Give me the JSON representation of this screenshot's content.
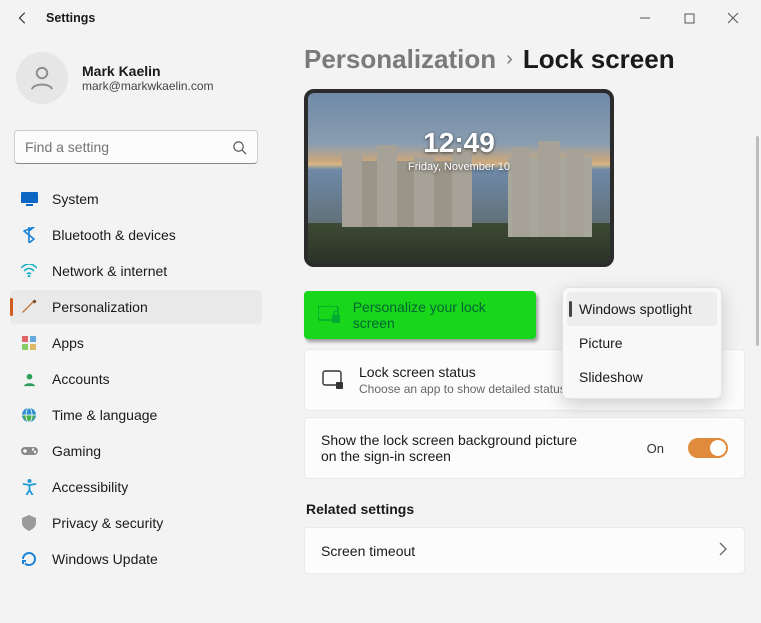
{
  "window": {
    "title": "Settings"
  },
  "profile": {
    "name": "Mark Kaelin",
    "email": "mark@markwkaelin.com"
  },
  "search": {
    "placeholder": "Find a setting"
  },
  "nav": {
    "items": [
      {
        "label": "System",
        "icon": "system",
        "selected": false
      },
      {
        "label": "Bluetooth & devices",
        "icon": "bluetooth",
        "selected": false
      },
      {
        "label": "Network & internet",
        "icon": "network",
        "selected": false
      },
      {
        "label": "Personalization",
        "icon": "personalization",
        "selected": true
      },
      {
        "label": "Apps",
        "icon": "apps",
        "selected": false
      },
      {
        "label": "Accounts",
        "icon": "accounts",
        "selected": false
      },
      {
        "label": "Time & language",
        "icon": "time",
        "selected": false
      },
      {
        "label": "Gaming",
        "icon": "gaming",
        "selected": false
      },
      {
        "label": "Accessibility",
        "icon": "accessibility",
        "selected": false
      },
      {
        "label": "Privacy & security",
        "icon": "privacy",
        "selected": false
      },
      {
        "label": "Windows Update",
        "icon": "update",
        "selected": false
      }
    ]
  },
  "breadcrumb": {
    "parent": "Personalization",
    "current": "Lock screen"
  },
  "preview": {
    "time": "12:49",
    "date": "Friday, November 10"
  },
  "hero": {
    "label": "Personalize your lock screen"
  },
  "dropdown": {
    "options": [
      {
        "label": "Windows spotlight",
        "selected": true
      },
      {
        "label": "Picture",
        "selected": false
      },
      {
        "label": "Slideshow",
        "selected": false
      }
    ]
  },
  "status_card": {
    "title": "Lock screen status",
    "sub": "Choose an app to show detailed status on the lock screen"
  },
  "bg_card": {
    "title": "Show the lock screen background picture on the sign-in screen",
    "state": "On"
  },
  "related": {
    "header": "Related settings",
    "items": [
      {
        "label": "Screen timeout"
      }
    ]
  }
}
